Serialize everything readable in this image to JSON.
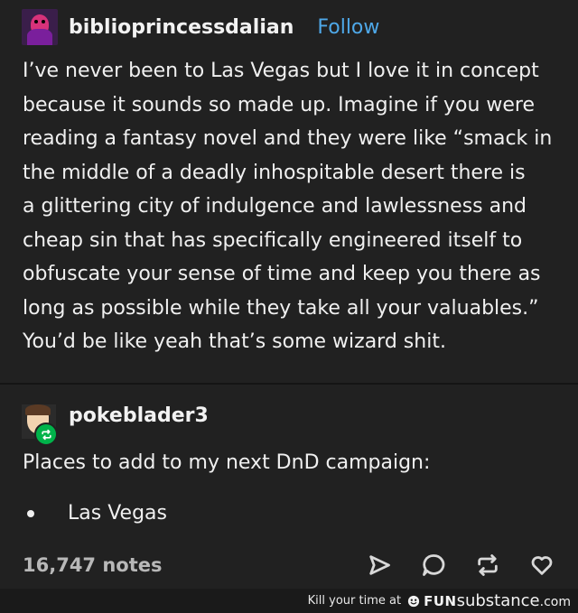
{
  "post": {
    "author": "biblioprincessdalian",
    "follow_label": "Follow",
    "body_lines": [
      "I’ve never been to Las Vegas but I love it in concept",
      "because it sounds so made up. Imagine if you were",
      "reading a fantasy novel and they were like “smack in",
      "the middle of a deadly inhospitable desert there is",
      "a glittering city of indulgence and lawlessness and",
      "cheap sin that has specifically engineered itself to",
      "obfuscate your sense of time and keep you there as",
      "long as possible while they take all your valuables.”",
      "You’d be like yeah that’s some wizard shit."
    ]
  },
  "reblog": {
    "author": "pokeblader3",
    "text": "Places to add to my next DnD campaign:",
    "list_items": [
      "Las Vegas"
    ]
  },
  "footer": {
    "notes": "16,747 notes",
    "actions": [
      "send-icon",
      "reply-icon",
      "reblog-icon",
      "like-icon"
    ]
  },
  "banner": {
    "tagline": "Kill your time at",
    "brand_fun": "FUN",
    "brand_substance": "substance",
    "brand_tld": ".com"
  },
  "colors": {
    "background": "#212121",
    "text": "#f0f0f0",
    "follow_link": "#4ea8e8",
    "reblog_badge": "#00b34a",
    "notes_text": "#b8b8b8"
  }
}
